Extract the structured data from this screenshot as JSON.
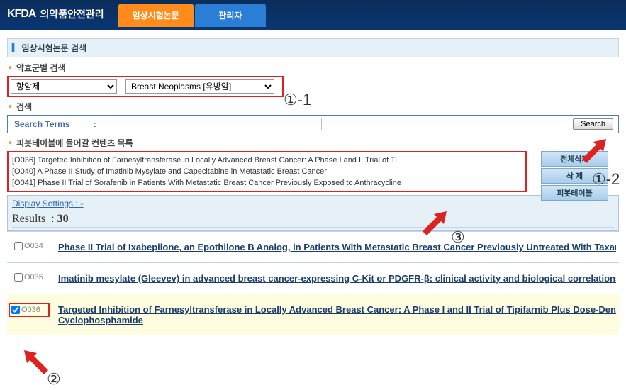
{
  "header": {
    "logo_brand": "KFDA",
    "logo_text": "의약품안전관리",
    "tab_active": "임상시험논문",
    "tab_inactive": "관리자"
  },
  "sections": {
    "search_title": "임상시험논문 검색",
    "group_search": "약효군별 검색",
    "simple_search": "검색",
    "pivot_list": "피봇테이블에 들어갈 컨텐츠 목록"
  },
  "dropdowns": {
    "category": "항암제",
    "disease": "Breast Neoplasms [유방암]"
  },
  "search": {
    "label": "Search Terms",
    "colon": ":",
    "placeholder": "",
    "button": "Search"
  },
  "selected_items": [
    "[O036] Targeted Inhibition of Farnesyltransferase in Locally Advanced Breast Cancer: A Phase I and II Trial of Ti",
    "[O040] A Phase II Study of Imatinib Mysylate and Capecitabine in Metastatic Breast Cancer",
    "[O041] Phase II Trial of Sorafenib in Patients With Metastatic Breast Cancer Previously Exposed to Anthracycline"
  ],
  "side_buttons": {
    "delete_all": "전체삭제",
    "delete": "삭  제",
    "pivot": "피봇테이블"
  },
  "display": {
    "settings_label": "Display Settings :",
    "results_label": "Results",
    "results_colon": ":",
    "results_count": "30"
  },
  "results": [
    {
      "id": "O034",
      "checked": false,
      "title": "Phase II Trial of Ixabepilone, an Epothilone B Analog, in Patients With Metastatic Breast Cancer Previously Untreated With Taxan"
    },
    {
      "id": "O035",
      "checked": false,
      "title": "Imatinib mesylate (Gleevev) in advanced breast cancer-expressing C-Kit or PDGFR-β: clinical activity and biological correlations"
    },
    {
      "id": "O036",
      "checked": true,
      "title": "Targeted Inhibition of Farnesyltransferase in Locally Advanced Breast Cancer: A Phase I and II Trial of Tipifarnib Plus Dose-Dense",
      "subtitle": "Cyclophosphamide"
    }
  ],
  "annotations": {
    "a1_1": "①-1",
    "a1_2": "①-2",
    "a2": "②",
    "a3": "③"
  }
}
